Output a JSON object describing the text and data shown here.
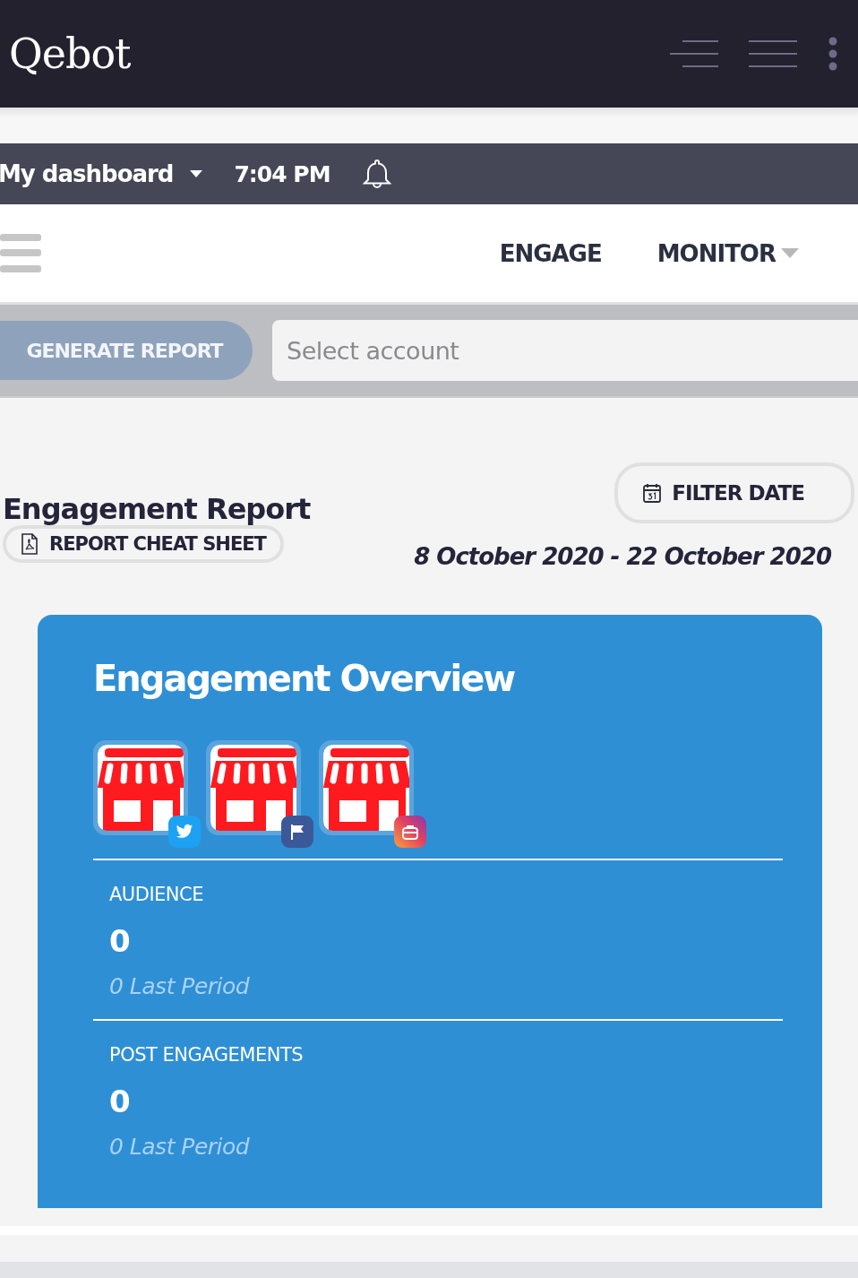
{
  "header": {
    "logo": "Qebot"
  },
  "dashboard_bar": {
    "title": "My dashboard",
    "time": "7:04 PM"
  },
  "nav": {
    "items": [
      {
        "label": "ENGAGE",
        "dropdown": false
      },
      {
        "label": "MONITOR",
        "dropdown": true
      }
    ]
  },
  "toolbar": {
    "generate_button": {
      "label": "GENERATE REPORT",
      "disabled": true
    },
    "account_select": {
      "placeholder": "Select account"
    }
  },
  "report": {
    "title": "Engagement Report",
    "cheat_sheet_button": "REPORT CHEAT SHEET",
    "filter_button": "FILTER DATE",
    "date_range": "8 October 2020 - 22 October 2020"
  },
  "overview": {
    "title": "Engagement Overview",
    "accounts": [
      {
        "kind": "twitter"
      },
      {
        "kind": "facebook"
      },
      {
        "kind": "instagram"
      }
    ],
    "metrics": [
      {
        "label": "AUDIENCE",
        "value": "0",
        "previous": "0 Last Period"
      },
      {
        "label": "POST ENGAGEMENTS",
        "value": "0",
        "previous": "0 Last Period"
      }
    ]
  }
}
